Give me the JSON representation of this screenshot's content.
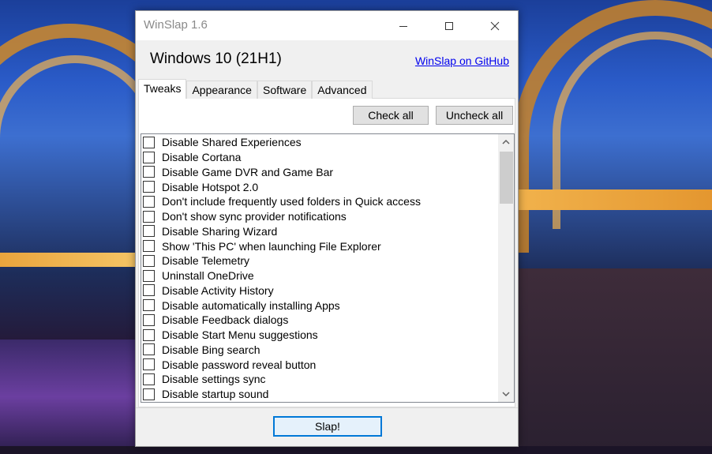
{
  "window": {
    "title": "WinSlap 1.6",
    "os_label": "Windows 10 (21H1)",
    "github_link": "WinSlap on GitHub"
  },
  "tabs": [
    {
      "label": "Tweaks",
      "active": true
    },
    {
      "label": "Appearance",
      "active": false
    },
    {
      "label": "Software",
      "active": false
    },
    {
      "label": "Advanced",
      "active": false
    }
  ],
  "toolbar": {
    "check_all": "Check all",
    "uncheck_all": "Uncheck all"
  },
  "tweaks": [
    {
      "label": "Disable Shared Experiences",
      "checked": false
    },
    {
      "label": "Disable Cortana",
      "checked": false
    },
    {
      "label": "Disable Game DVR and Game Bar",
      "checked": false
    },
    {
      "label": "Disable Hotspot 2.0",
      "checked": false
    },
    {
      "label": "Don't include frequently used folders in Quick access",
      "checked": false
    },
    {
      "label": "Don't show sync provider notifications",
      "checked": false
    },
    {
      "label": "Disable Sharing Wizard",
      "checked": false
    },
    {
      "label": "Show 'This PC' when launching File Explorer",
      "checked": false
    },
    {
      "label": "Disable Telemetry",
      "checked": false
    },
    {
      "label": "Uninstall OneDrive",
      "checked": false
    },
    {
      "label": "Disable Activity History",
      "checked": false
    },
    {
      "label": "Disable automatically installing Apps",
      "checked": false
    },
    {
      "label": "Disable Feedback dialogs",
      "checked": false
    },
    {
      "label": "Disable Start Menu suggestions",
      "checked": false
    },
    {
      "label": "Disable Bing search",
      "checked": false
    },
    {
      "label": "Disable password reveal button",
      "checked": false
    },
    {
      "label": "Disable settings sync",
      "checked": false
    },
    {
      "label": "Disable startup sound",
      "checked": false
    }
  ],
  "footer": {
    "slap": "Slap!"
  },
  "colors": {
    "accent": "#0078d7",
    "link": "#0000ee"
  }
}
